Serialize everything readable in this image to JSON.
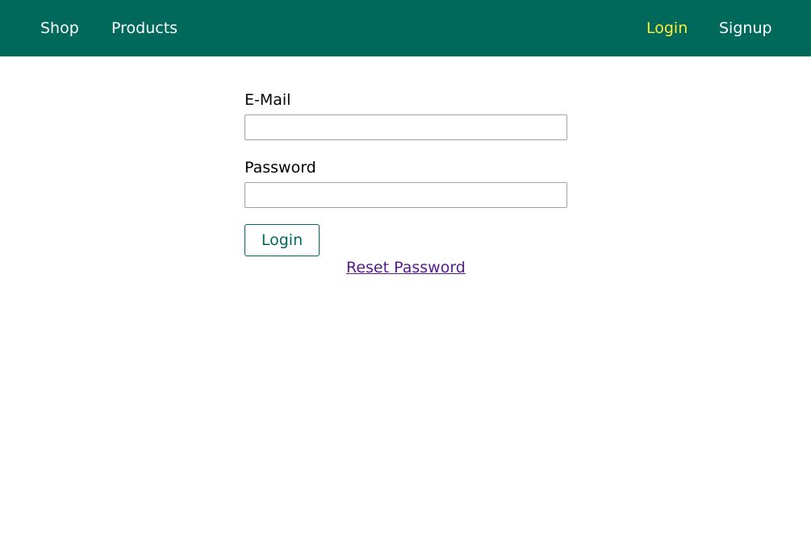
{
  "header": {
    "nav_left": [
      {
        "label": "Shop"
      },
      {
        "label": "Products"
      }
    ],
    "nav_right": [
      {
        "label": "Login",
        "active": true
      },
      {
        "label": "Signup",
        "active": false
      }
    ]
  },
  "form": {
    "email_label": "E-Mail",
    "email_value": "",
    "password_label": "Password",
    "password_value": "",
    "login_button": "Login",
    "reset_link": "Reset Password"
  },
  "colors": {
    "header_bg": "#00695c",
    "active_nav": "#ffeb3b",
    "button_accent": "#00695c",
    "visited_link": "#551a8b"
  }
}
